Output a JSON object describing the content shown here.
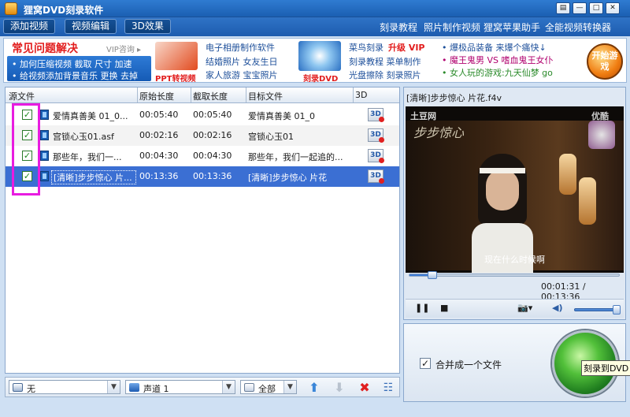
{
  "window": {
    "title": "狸窝DVD刻录软件",
    "controls": {
      "settings": "▤",
      "minimize": "—",
      "maximize": "□",
      "close": "✕"
    }
  },
  "toolbar": {
    "buttons": [
      "添加视频",
      "视频编辑",
      "3D效果"
    ],
    "links": [
      "刻录教程",
      "照片制作视频",
      "狸窝苹果助手",
      "全能视频转换器"
    ]
  },
  "banner": {
    "faq_title": "常见问题解决",
    "faq_vip": "VIP咨询 ▸",
    "faq_line1": "• 加何压缩视频 截取 尺寸 加速",
    "faq_line2": "• 给视频添加背景音乐 更换 去掉",
    "ppt_caption": "PPT转视频",
    "photo_links": [
      "电子相册制作软件",
      "结婚照片 女友生日",
      "家人旅游 宝宝照片"
    ],
    "dvd_caption": "刻录DVD",
    "burn_links": [
      "菜鸟刻录",
      "升级 VIP",
      "刻录教程 菜单制作",
      "光盘擦除 刻录照片"
    ],
    "news": [
      "• 爆极品装备 来爆个痛快↓",
      "• 魔王鬼男 VS 嗜血鬼王女仆",
      "• 女人玩的游戏:九天仙梦 go"
    ],
    "game_button": "开始游戏"
  },
  "table": {
    "headers": [
      "源文件",
      "原始长度",
      "截取长度",
      "目标文件",
      "3D"
    ],
    "rows": [
      {
        "checked": true,
        "source": "爱情真善美 01_0...",
        "original": "00:05:40",
        "clip": "00:05:40",
        "target": "爱情真善美 01_0",
        "threed": "3D"
      },
      {
        "checked": true,
        "source": "宫锁心玉01.asf",
        "original": "00:02:16",
        "clip": "00:02:16",
        "target": "宫锁心玉01",
        "threed": "3D"
      },
      {
        "checked": true,
        "source": "那些年，我们一...",
        "original": "00:04:30",
        "clip": "00:04:30",
        "target": "那些年，我们一起追的...",
        "threed": "3D"
      },
      {
        "checked": true,
        "source": "[清晰]步步惊心 片...",
        "original": "00:13:36",
        "clip": "00:13:36",
        "target": "[清晰]步步惊心 片花",
        "threed": "3D"
      }
    ]
  },
  "bottom": {
    "subtitle_select": "无",
    "audio_select": "声道 1",
    "range_select": "全部",
    "actions": {
      "up": "⬆",
      "down": "⬇",
      "delete": "✖",
      "clear": "☷"
    }
  },
  "preview": {
    "filename": "[清晰]步步惊心 片花.f4v",
    "watermark_left": "土豆网",
    "watermark_right": "优酷",
    "watermark_script": "步步惊心",
    "subtitle": "现在什么时候啊",
    "time": "00:01:31 / 00:13:36",
    "progress": 0.11,
    "volume": 1.0,
    "controls": {
      "pause": "❚❚",
      "stop": "■",
      "camera": "📷▾",
      "volume": "◀)"
    }
  },
  "burn": {
    "merge_label": "合并成一个文件",
    "merge_checked": true,
    "burn_tooltip": "刻录到DVD"
  }
}
